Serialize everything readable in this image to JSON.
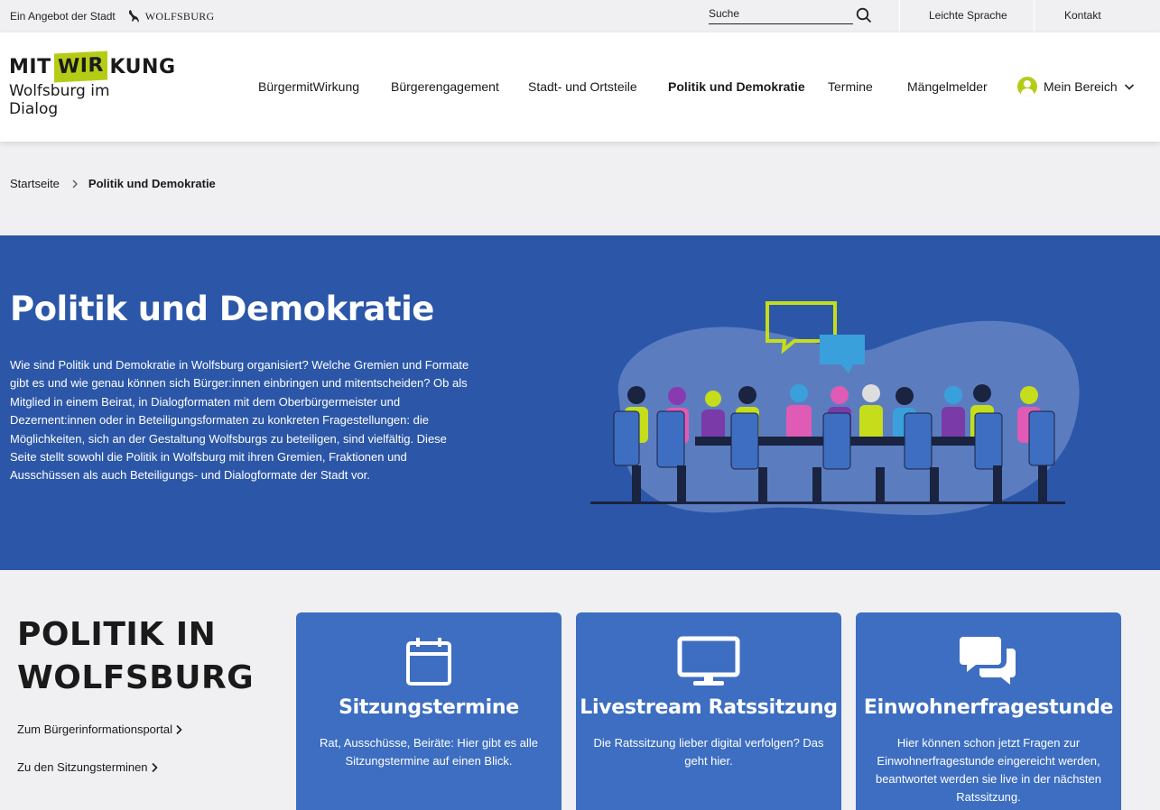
{
  "topbar": {
    "offer_text": "Ein Angebot der Stadt",
    "city_brand": "WOLFSBURG",
    "search_placeholder": "Suche",
    "leichte_sprache": "Leichte Sprache",
    "kontakt": "Kontakt"
  },
  "header": {
    "logo_mit": "MIT",
    "logo_wir": "WIR",
    "logo_kung": "KUNG",
    "logo_subtitle": "Wolfsburg im Dialog",
    "nav": [
      {
        "label": "BürgermitWirkung"
      },
      {
        "label": "Bürgerengagement"
      },
      {
        "label": "Stadt- und Ortsteile"
      },
      {
        "label": "Politik und Demokratie",
        "active": true
      },
      {
        "label": "Termine"
      },
      {
        "label": "Mängelmelder"
      }
    ],
    "mein_bereich": "Mein Bereich"
  },
  "breadcrumb": {
    "home": "Startseite",
    "current": "Politik und Demokratie"
  },
  "hero": {
    "title": "Politik und Demokratie",
    "text": "Wie sind Politik und Demokratie in Wolfsburg organisiert? Welche Gremien und Formate gibt es und wie genau können sich Bürger:innen einbringen und mitentscheiden? Ob als Mitglied in einem Beirat, in Dialogformaten mit dem Oberbürgermeister und Dezernent:innen oder in Beteiligungsformaten zu konkreten Fragestellungen: die Möglichkeiten, sich an der Gestaltung Wolfsburgs zu beteiligen, sind vielfältig. Diese Seite stellt sowohl die Politik in Wolfsburg mit ihren Gremien, Fraktionen und Ausschüssen als auch Beteiligungs- und Dialogformate der Stadt vor."
  },
  "politik": {
    "title_line1": "POLITIK IN",
    "title_line2": "WOLFSBURG",
    "links": [
      {
        "label": "Zum Bürgerinformationsportal"
      },
      {
        "label": "Zu den Sitzungsterminen"
      }
    ]
  },
  "cards": [
    {
      "icon": "calendar-icon",
      "title": "Sitzungstermine",
      "text": "Rat, Ausschüsse, Beiräte: Hier gibt es alle Sitzungstermine auf einen Blick."
    },
    {
      "icon": "monitor-icon",
      "title": "Livestream Ratssitzung",
      "text": "Die Ratssitzung lieber digital verfolgen? Das geht hier."
    },
    {
      "icon": "chat-bubbles-icon",
      "title": "Einwohnerfragestunde",
      "text": "Hier können schon jetzt Fragen zur Einwohnerfragestunde eingereicht werden, beantwortet werden sie live in der nächsten Ratssitzung."
    }
  ],
  "colors": {
    "brand_green": "#b5cc17",
    "hero_blue": "#2c57a8",
    "card_blue": "#3d6ec1"
  }
}
